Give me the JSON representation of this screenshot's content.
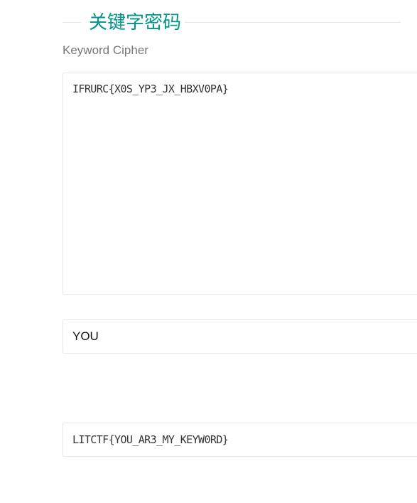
{
  "header": {
    "title": "关键字密码",
    "subtitle": "Keyword Cipher"
  },
  "cipher": {
    "text": "IFRURC{X0S_YP3_JX_HBXV0PA}"
  },
  "key": {
    "value": "YOU"
  },
  "result": {
    "text": "LITCTF{YOU_AR3_MY_KEYW0RD}"
  },
  "colors": {
    "accent": "#009688",
    "border": "#e6e6e6",
    "subtitle": "#777777"
  }
}
